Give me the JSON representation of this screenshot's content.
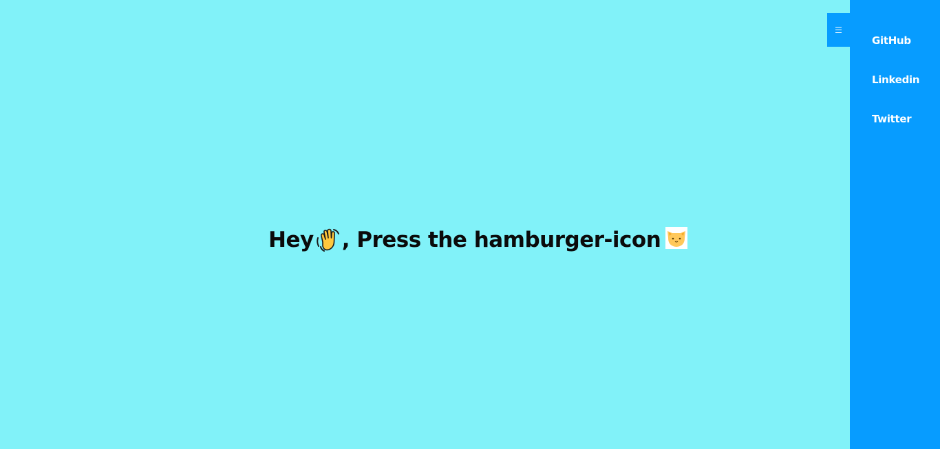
{
  "page": {
    "background": "#81F2F9",
    "accent": "#079CFF"
  },
  "hero": {
    "text_hey": "Hey",
    "wave_icon": "waving-hand-icon",
    "text_rest": ", Press the hamburger-icon",
    "cat_icon": "cat-face-icon"
  },
  "menu_button": {
    "icon": "hamburger-icon"
  },
  "sidebar": {
    "items": [
      {
        "label": "GitHub"
      },
      {
        "label": "Linkedin"
      },
      {
        "label": "Twitter"
      }
    ]
  }
}
